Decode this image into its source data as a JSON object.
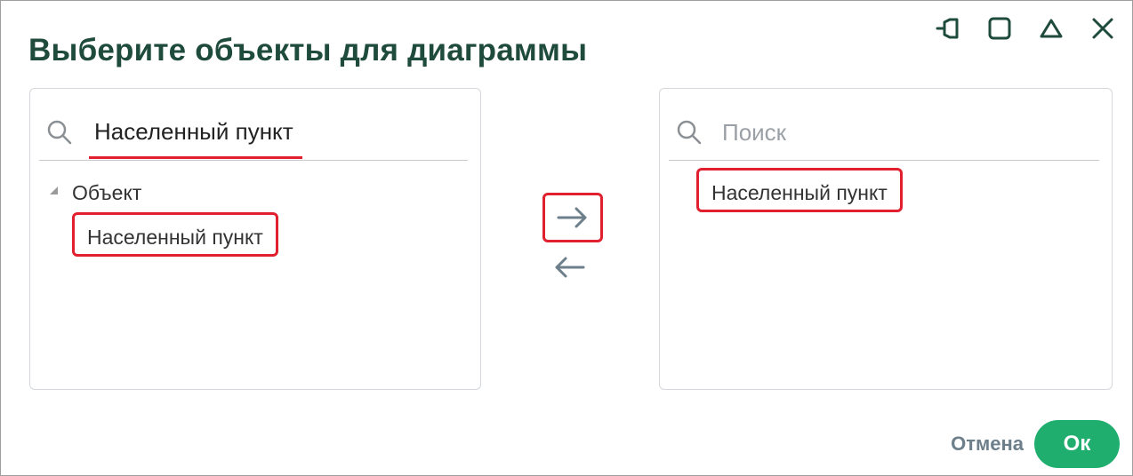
{
  "dialog": {
    "title": "Выберите объекты для диаграммы"
  },
  "window_controls": [
    "pin-icon",
    "maximize-icon",
    "collapse-icon",
    "close-icon"
  ],
  "left_panel": {
    "search_value": "Населенный пункт",
    "tree": {
      "group_label": "Объект",
      "items": [
        "Населенный пункт"
      ]
    }
  },
  "transfer": {
    "move_right_icon": "arrow-right-icon",
    "move_left_icon": "arrow-left-icon"
  },
  "right_panel": {
    "search_placeholder": "Поиск",
    "items": [
      "Населенный пункт"
    ]
  },
  "footer": {
    "cancel_label": "Отмена",
    "ok_label": "Ок"
  },
  "colors": {
    "title": "#1f4b3c",
    "highlight": "#e0202e",
    "ok_button": "#1fae6e",
    "icon": "#1f4b3c",
    "arrow": "#6e7f8c"
  }
}
